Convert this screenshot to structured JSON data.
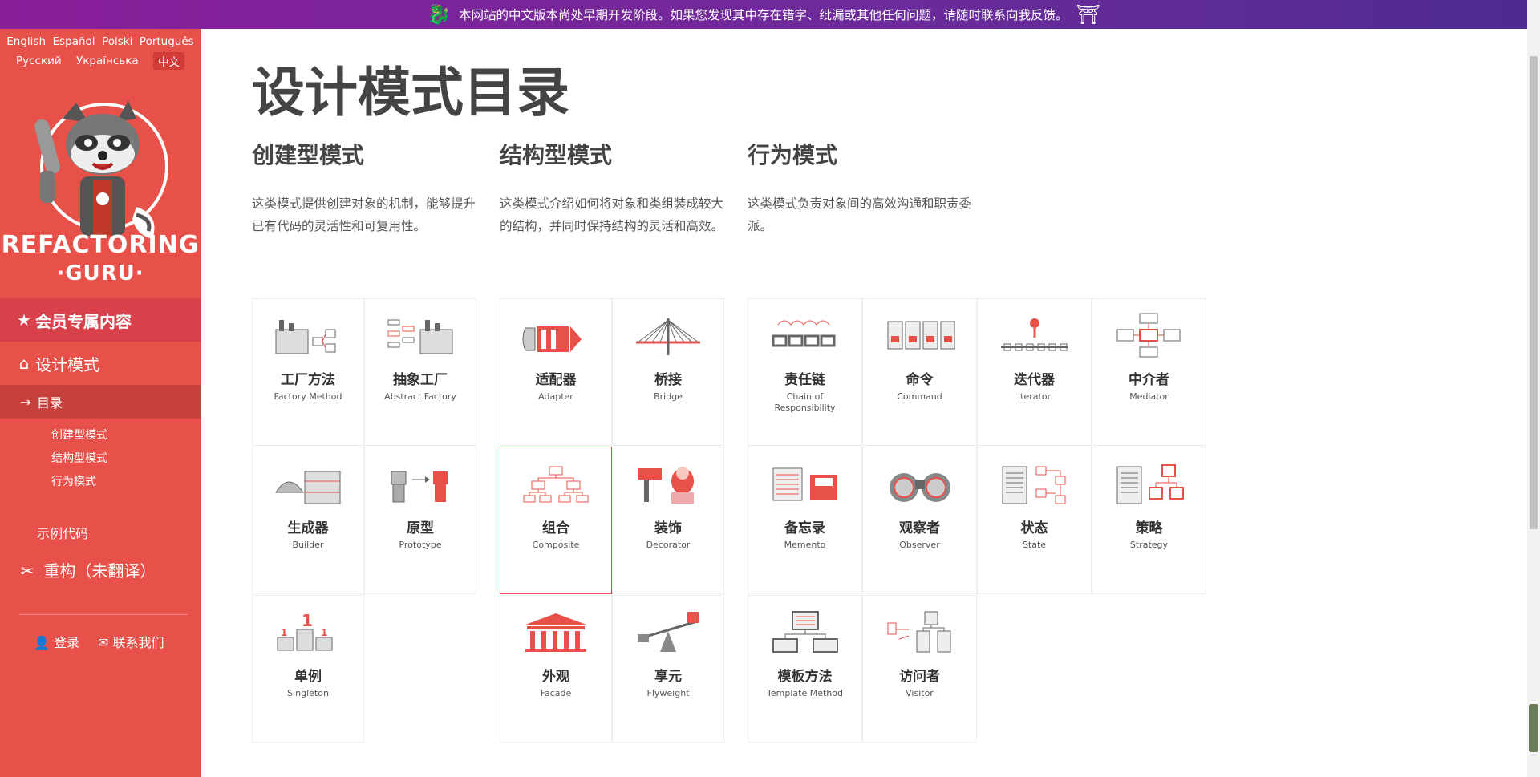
{
  "banner": {
    "text": "本网站的中文版本尚处早期开发阶段。如果您发现其中存在错字、纰漏或其他任何问题，请随时联系向我反馈。"
  },
  "languages": {
    "row1": [
      "English",
      "Español",
      "Polski",
      "Português"
    ],
    "row2": [
      "Русский",
      "Українська",
      "中文"
    ],
    "active": "中文"
  },
  "brand": {
    "line1": "REFACTORING",
    "line2": "·GURU·"
  },
  "sidebar": {
    "premium": "会员专属内容",
    "design_patterns": "设计模式",
    "catalog": "目录",
    "sub": [
      "创建型模式",
      "结构型模式",
      "行为模式"
    ],
    "examples": "示例代码",
    "refactoring": "重构（未翻译）",
    "login": "登录",
    "contact": "联系我们"
  },
  "page": {
    "title": "设计模式目录"
  },
  "columns": [
    {
      "title": "创建型模式",
      "desc": "这类模式提供创建对象的机制，能够提升已有代码的灵活性和可复用性。",
      "patterns": [
        {
          "zh": "工厂方法",
          "en": "Factory Method",
          "icon": "factory-method-icon"
        },
        {
          "zh": "抽象工厂",
          "en": "Abstract Factory",
          "icon": "abstract-factory-icon"
        },
        {
          "zh": "生成器",
          "en": "Builder",
          "icon": "builder-icon"
        },
        {
          "zh": "原型",
          "en": "Prototype",
          "icon": "prototype-icon"
        },
        {
          "zh": "单例",
          "en": "Singleton",
          "icon": "singleton-icon"
        }
      ]
    },
    {
      "title": "结构型模式",
      "desc": "这类模式介绍如何将对象和类组装成较大的结构，并同时保持结构的灵活和高效。",
      "patterns": [
        {
          "zh": "适配器",
          "en": "Adapter",
          "icon": "adapter-icon"
        },
        {
          "zh": "桥接",
          "en": "Bridge",
          "icon": "bridge-icon"
        },
        {
          "zh": "组合",
          "en": "Composite",
          "icon": "composite-icon"
        },
        {
          "zh": "装饰",
          "en": "Decorator",
          "icon": "decorator-icon"
        },
        {
          "zh": "外观",
          "en": "Facade",
          "icon": "facade-icon"
        },
        {
          "zh": "享元",
          "en": "Flyweight",
          "icon": "flyweight-icon"
        }
      ]
    },
    {
      "title": "行为模式",
      "desc": "这类模式负责对象间的高效沟通和职责委派。",
      "patterns": [
        {
          "zh": "责任链",
          "en": "Chain of Responsibility",
          "icon": "chain-icon"
        },
        {
          "zh": "命令",
          "en": "Command",
          "icon": "command-icon"
        },
        {
          "zh": "迭代器",
          "en": "Iterator",
          "icon": "iterator-icon"
        },
        {
          "zh": "中介者",
          "en": "Mediator",
          "icon": "mediator-icon"
        },
        {
          "zh": "备忘录",
          "en": "Memento",
          "icon": "memento-icon"
        },
        {
          "zh": "观察者",
          "en": "Observer",
          "icon": "observer-icon"
        },
        {
          "zh": "状态",
          "en": "State",
          "icon": "state-icon"
        },
        {
          "zh": "策略",
          "en": "Strategy",
          "icon": "strategy-icon"
        },
        {
          "zh": "模板方法",
          "en": "Template Method",
          "icon": "template-method-icon"
        },
        {
          "zh": "访问者",
          "en": "Visitor",
          "icon": "visitor-icon"
        }
      ]
    }
  ],
  "colors": {
    "accent": "#e8514a",
    "banner": "#6b2b9a"
  }
}
